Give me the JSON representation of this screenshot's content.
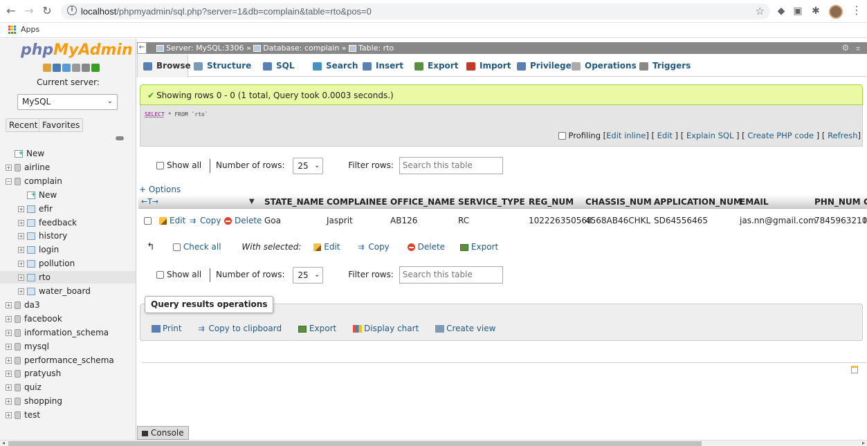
{
  "browser": {
    "url_host": "localhost",
    "url_path": "/phpmyadmin/sql.php?server=1&db=complain&table=rto&pos=0",
    "bookmarks_apps": "Apps"
  },
  "sidebar": {
    "logo_php": "php",
    "logo_myadmin": "MyAdmin",
    "current_server_label": "Current server:",
    "server_value": "MySQL",
    "recent_label": "Recent",
    "favorites_label": "Favorites",
    "tree": [
      {
        "label": "New",
        "type": "new",
        "indent": 0
      },
      {
        "label": "airline",
        "type": "db",
        "indent": 0
      },
      {
        "label": "complain",
        "type": "db-open",
        "indent": 0
      },
      {
        "label": "New",
        "type": "new",
        "indent": 1
      },
      {
        "label": "efir",
        "type": "table",
        "indent": 1
      },
      {
        "label": "feedback",
        "type": "table",
        "indent": 1
      },
      {
        "label": "history",
        "type": "table",
        "indent": 1
      },
      {
        "label": "login",
        "type": "table",
        "indent": 1
      },
      {
        "label": "pollution",
        "type": "table",
        "indent": 1
      },
      {
        "label": "rto",
        "type": "table",
        "indent": 1,
        "selected": true
      },
      {
        "label": "water_board",
        "type": "table",
        "indent": 1
      },
      {
        "label": "da3",
        "type": "db",
        "indent": 0
      },
      {
        "label": "facebook",
        "type": "db",
        "indent": 0
      },
      {
        "label": "information_schema",
        "type": "db",
        "indent": 0
      },
      {
        "label": "mysql",
        "type": "db",
        "indent": 0
      },
      {
        "label": "performance_schema",
        "type": "db",
        "indent": 0
      },
      {
        "label": "pratyush",
        "type": "db",
        "indent": 0
      },
      {
        "label": "quiz",
        "type": "db",
        "indent": 0
      },
      {
        "label": "shopping",
        "type": "db",
        "indent": 0
      },
      {
        "label": "test",
        "type": "db",
        "indent": 0
      }
    ]
  },
  "breadcrumb": {
    "server": "Server: MySQL:3306",
    "database": "Database: complain",
    "table": "Table: rto",
    "separator": "»"
  },
  "tabs": [
    {
      "label": "Browse",
      "active": true
    },
    {
      "label": "Structure"
    },
    {
      "label": "SQL"
    },
    {
      "label": "Search"
    },
    {
      "label": "Insert"
    },
    {
      "label": "Export"
    },
    {
      "label": "Import"
    },
    {
      "label": "Privileges"
    },
    {
      "label": "Operations"
    },
    {
      "label": "Triggers"
    }
  ],
  "result": {
    "message": "Showing rows 0 - 0 (1 total, Query took 0.0003 seconds.)",
    "sql_keyword": "SELECT",
    "sql_rest": " * FROM `rto`",
    "profiling_label": "Profiling",
    "links": [
      "Edit inline",
      "Edit",
      "Explain SQL",
      "Create PHP code",
      "Refresh"
    ]
  },
  "nav": {
    "show_all": "Show all",
    "number_of_rows_label": "Number of rows:",
    "rows_value": "25",
    "filter_label": "Filter rows:",
    "filter_placeholder": "Search this table"
  },
  "options_link": "+ Options",
  "table": {
    "columns": [
      "STATE_NAME",
      "COMPLAINEE",
      "OFFICE_NAME",
      "SERVICE_TYPE",
      "REG_NUM",
      "CHASSIS_NUM",
      "APPLICATION_NUM",
      "EMAIL",
      "PHN_NUM",
      "C"
    ],
    "row_actions": [
      "Edit",
      "Copy",
      "Delete"
    ],
    "rows": [
      [
        "Goa",
        "Jasprit",
        "AB126",
        "RC",
        "102226350568",
        "4568AB46CHKL",
        "SD64556465",
        "jas.nn@gmail.com",
        "7845963210",
        "I"
      ]
    ]
  },
  "with_selected": {
    "check_all": "Check all",
    "label": "With selected:",
    "actions": [
      "Edit",
      "Copy",
      "Delete",
      "Export"
    ]
  },
  "query_ops": {
    "legend": "Query results operations",
    "links": [
      "Print",
      "Copy to clipboard",
      "Export",
      "Display chart",
      "Create view"
    ]
  },
  "console_label": "Console"
}
